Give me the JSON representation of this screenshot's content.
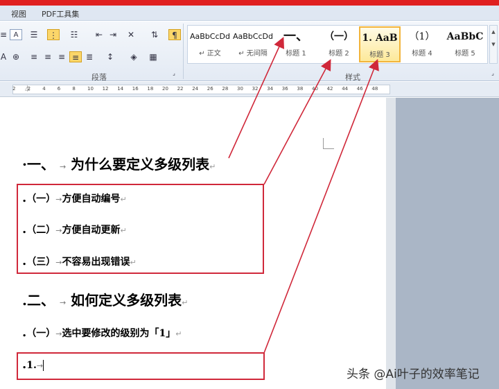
{
  "menu": {
    "items": [
      "视图",
      "PDF工具集"
    ]
  },
  "ribbon": {
    "paragraph_group_label": "段落",
    "styles_group_label": "样式",
    "styles": [
      {
        "preview": "AaBbCcDd",
        "name": "↵ 正文"
      },
      {
        "preview": "AaBbCcDd",
        "name": "↵ 无间隔"
      },
      {
        "preview": "一、",
        "name": "标题 1"
      },
      {
        "preview": "（一）",
        "name": "标题 2"
      },
      {
        "preview": "1. AaB",
        "name": "标题 3"
      },
      {
        "preview": "（1）",
        "name": "标题 4"
      },
      {
        "preview": "AaBbC",
        "name": "标题 5"
      }
    ],
    "selected_style": "标题 3"
  },
  "ruler": {
    "ticks": [
      "2",
      "2",
      "4",
      "6",
      "8",
      "10",
      "12",
      "14",
      "16",
      "18",
      "20",
      "22",
      "24",
      "26",
      "28",
      "30",
      "32",
      "34",
      "36",
      "38",
      "40",
      "42",
      "44",
      "46",
      "48"
    ]
  },
  "document": {
    "heading1_a": "·一、",
    "heading1_a_text": "为什么要定义多级列表",
    "item1": "（一）",
    "item1_text": "方便自动编号",
    "item2": "（二）",
    "item2_text": "方便自动更新",
    "item3": "（三）",
    "item3_text": "不容易出现错误",
    "heading1_b": ".二、",
    "heading1_b_text": "如何定义多级列表",
    "item4": "（一）",
    "item4_text": "选中要修改的级别为「1」",
    "item5": "1.",
    "tab_symbol": "→",
    "para_mark": "↵",
    "bullet": "."
  },
  "watermark": "头条 @Ai叶子的效率笔记",
  "colors": {
    "highlight": "#d0283a",
    "selected_style_border": "#f2b43a",
    "title_bar": "#e02020"
  }
}
